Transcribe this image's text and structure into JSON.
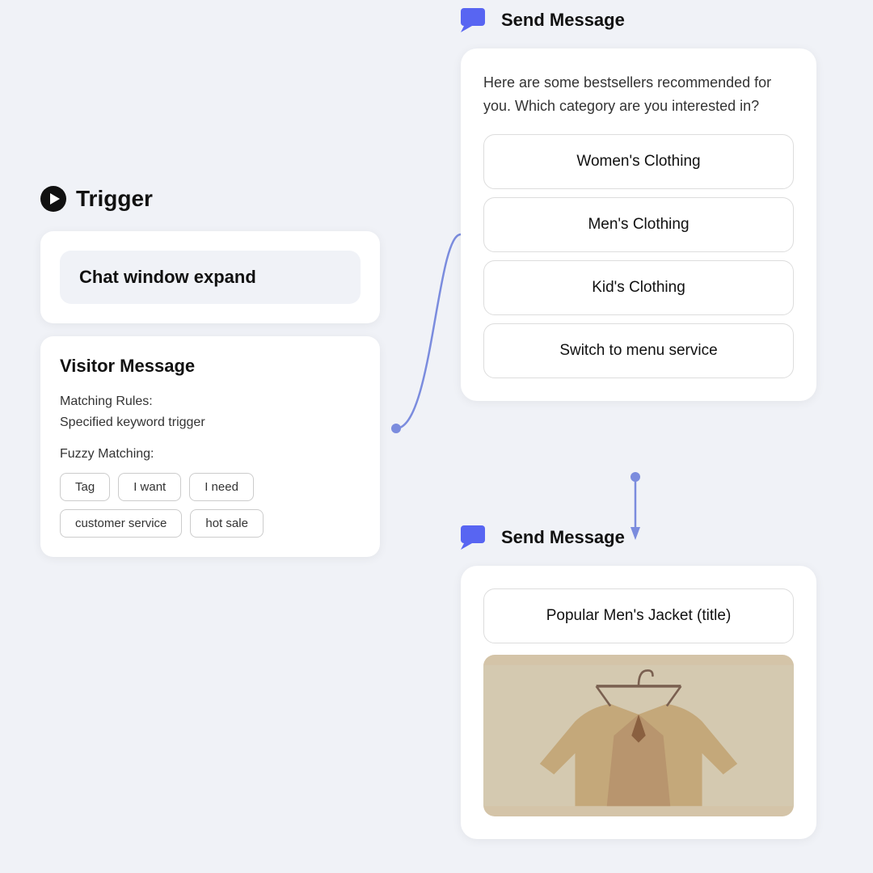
{
  "trigger": {
    "icon_label": "play-icon",
    "title": "Trigger"
  },
  "left_panel": {
    "chat_window_card": {
      "label": "Chat window expand"
    },
    "visitor_card": {
      "title": "Visitor Message",
      "matching_rules_label": "Matching Rules:",
      "matching_rules_value": "Specified keyword trigger",
      "fuzzy_matching_label": "Fuzzy Matching:",
      "tags": [
        "Tag",
        "I want",
        "I need",
        "customer service",
        "hot sale"
      ]
    }
  },
  "right_panel": {
    "send_message_header": {
      "icon_label": "chat-icon",
      "title": "Send Message"
    },
    "message_text": "Here are some bestsellers recommended for you. Which category are you interested in?",
    "options": [
      "Women's Clothing",
      "Men's Clothing",
      "Kid's Clothing",
      "Switch to menu service"
    ]
  },
  "second_block": {
    "send_message_header": {
      "icon_label": "chat-icon",
      "title": "Send Message"
    },
    "product_title": "Popular Men's Jacket (title)"
  },
  "colors": {
    "accent": "#5865f2",
    "background": "#f0f2f7",
    "card_bg": "white"
  }
}
